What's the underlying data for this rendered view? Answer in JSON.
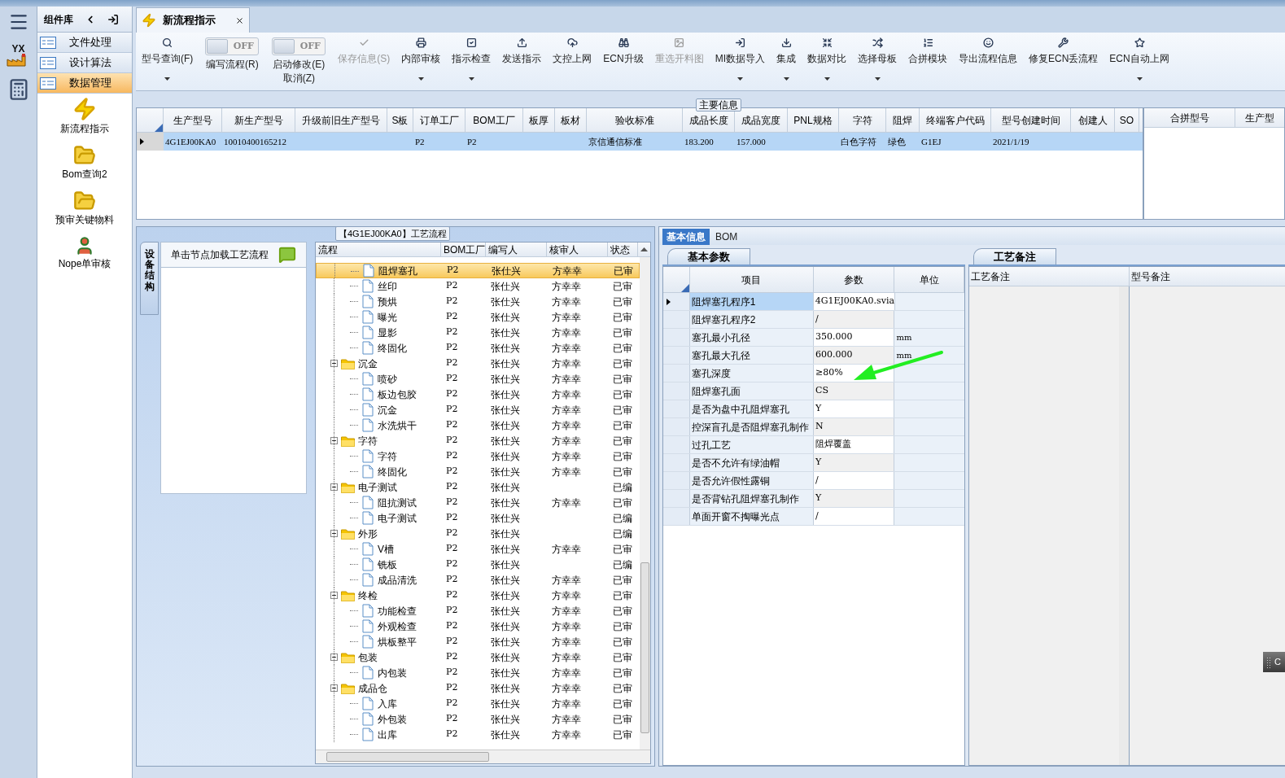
{
  "side_bar": {
    "logo_text": "YX"
  },
  "lib_panel": {
    "title": "组件库",
    "categories": [
      {
        "label": "文件处理",
        "selected": false
      },
      {
        "label": "设计算法",
        "selected": false
      },
      {
        "label": "数据管理",
        "selected": true
      }
    ],
    "launchers": [
      {
        "label": "新流程指示"
      },
      {
        "label": "Bom查询2"
      },
      {
        "label": "预审关键物料"
      },
      {
        "label": "Nope单审核"
      }
    ]
  },
  "doc_tabs": [
    {
      "label": "新流程指示",
      "selected": true
    }
  ],
  "toolbar": [
    {
      "kind": "button",
      "label": "型号查询(F)",
      "dropdown": true,
      "disabled": false
    },
    {
      "kind": "toggle",
      "label": "编写流程(R)",
      "on": false,
      "switch_text": "OFF"
    },
    {
      "kind": "toggle",
      "label": "启动修改(E)",
      "on": false,
      "switch_text": "OFF",
      "sub_label": "取消(Z)"
    },
    {
      "kind": "button",
      "label": "保存信息(S)",
      "dropdown": false,
      "disabled": true
    },
    {
      "kind": "button",
      "label": "内部审核",
      "dropdown": true,
      "disabled": false
    },
    {
      "kind": "button",
      "label": "指示检查",
      "dropdown": true,
      "disabled": false
    },
    {
      "kind": "button",
      "label": "发送指示",
      "dropdown": false,
      "disabled": false
    },
    {
      "kind": "button",
      "label": "文控上网",
      "dropdown": false,
      "disabled": false
    },
    {
      "kind": "button",
      "label": "ECN升级",
      "dropdown": false,
      "disabled": false
    },
    {
      "kind": "button",
      "label": "重选开料图",
      "dropdown": false,
      "disabled": true
    },
    {
      "kind": "button",
      "label": "MI数据导入",
      "dropdown": true,
      "disabled": false
    },
    {
      "kind": "button",
      "label": "集成",
      "dropdown": true,
      "disabled": false
    },
    {
      "kind": "button",
      "label": "数据对比",
      "dropdown": true,
      "disabled": false
    },
    {
      "kind": "button",
      "label": "选择母板",
      "dropdown": true,
      "disabled": false
    },
    {
      "kind": "button",
      "label": "合拼模块",
      "dropdown": false,
      "disabled": false
    },
    {
      "kind": "button",
      "label": "导出流程信息",
      "dropdown": false,
      "disabled": false
    },
    {
      "kind": "button",
      "label": "修复ECN丢流程",
      "dropdown": false,
      "disabled": false
    },
    {
      "kind": "button",
      "label": "ECN自动上网",
      "dropdown": true,
      "disabled": false
    }
  ],
  "main_info": {
    "title": "主要信息",
    "columns": [
      "生产型号",
      "新生产型号",
      "升级前旧生产型号",
      "S板",
      "订单工厂",
      "BOM工厂",
      "板厚",
      "板材",
      "验收标准",
      "成品长度",
      "成品宽度",
      "PNL规格",
      "字符",
      "阻焊",
      "终端客户代码",
      "型号创建时间",
      "创建人",
      "SO"
    ],
    "rows": [
      {
        "selected": true,
        "cells": [
          "4G1EJ00KA0",
          "10010400165212",
          null,
          null,
          "P2",
          "P2",
          null,
          null,
          "京信通信标准",
          "183.200",
          "157.000",
          null,
          "白色字符",
          "绿色",
          "G1EJ",
          "2021/1/19",
          null,
          null
        ]
      }
    ]
  },
  "merge_table": {
    "columns": [
      "合拼型号",
      "生产型"
    ]
  },
  "process": {
    "vertical_tab": "设备结构",
    "hint": "单击节点加载工艺流程",
    "title": "【4G1EJ00KA0】工艺流程",
    "columns": [
      "流程",
      "BOM工厂",
      "编写人",
      "核审人",
      "状态"
    ],
    "rows": [
      {
        "kind": "step",
        "name": "阻焊塞孔",
        "bom": "P2",
        "writer": "张仕兴",
        "reviewer": "方幸幸",
        "status": "已审",
        "selected": true
      },
      {
        "kind": "step",
        "name": "丝印",
        "bom": "P2",
        "writer": "张仕兴",
        "reviewer": "方幸幸",
        "status": "已审",
        "selected": false
      },
      {
        "kind": "step",
        "name": "预烘",
        "bom": "P2",
        "writer": "张仕兴",
        "reviewer": "方幸幸",
        "status": "已审",
        "selected": false
      },
      {
        "kind": "step",
        "name": "曝光",
        "bom": "P2",
        "writer": "张仕兴",
        "reviewer": "方幸幸",
        "status": "已审",
        "selected": false
      },
      {
        "kind": "step",
        "name": "显影",
        "bom": "P2",
        "writer": "张仕兴",
        "reviewer": "方幸幸",
        "status": "已审",
        "selected": false
      },
      {
        "kind": "step",
        "name": "终固化",
        "bom": "P2",
        "writer": "张仕兴",
        "reviewer": "方幸幸",
        "status": "已审",
        "selected": false
      },
      {
        "kind": "group",
        "name": "沉金",
        "bom": "P2",
        "writer": "张仕兴",
        "reviewer": "方幸幸",
        "status": "已审",
        "selected": false,
        "expanded": true,
        "children": [
          {
            "kind": "step",
            "name": "喷砂",
            "bom": "P2",
            "writer": "张仕兴",
            "reviewer": "方幸幸",
            "status": "已审",
            "selected": false
          },
          {
            "kind": "step",
            "name": "板边包胶",
            "bom": "P2",
            "writer": "张仕兴",
            "reviewer": "方幸幸",
            "status": "已审",
            "selected": false
          },
          {
            "kind": "step",
            "name": "沉金",
            "bom": "P2",
            "writer": "张仕兴",
            "reviewer": "方幸幸",
            "status": "已审",
            "selected": false
          },
          {
            "kind": "step",
            "name": "水洗烘干",
            "bom": "P2",
            "writer": "张仕兴",
            "reviewer": "方幸幸",
            "status": "已审",
            "selected": false
          }
        ]
      },
      {
        "kind": "group",
        "name": "字符",
        "bom": "P2",
        "writer": "张仕兴",
        "reviewer": "方幸幸",
        "status": "已审",
        "selected": false,
        "expanded": true,
        "children": [
          {
            "kind": "step",
            "name": "字符",
            "bom": "P2",
            "writer": "张仕兴",
            "reviewer": "方幸幸",
            "status": "已审",
            "selected": false
          },
          {
            "kind": "step",
            "name": "终固化",
            "bom": "P2",
            "writer": "张仕兴",
            "reviewer": "方幸幸",
            "status": "已审",
            "selected": false
          }
        ]
      },
      {
        "kind": "group",
        "name": "电子测试",
        "bom": "P2",
        "writer": "张仕兴",
        "status": "已编",
        "selected": false,
        "expanded": true,
        "children": [
          {
            "kind": "step",
            "name": "阻抗测试",
            "bom": "P2",
            "writer": "张仕兴",
            "reviewer": "方幸幸",
            "status": "已审",
            "selected": false
          },
          {
            "kind": "step",
            "name": "电子测试",
            "bom": "P2",
            "writer": "张仕兴",
            "status": "已编",
            "selected": false
          }
        ]
      },
      {
        "kind": "group",
        "name": "外形",
        "bom": "P2",
        "writer": "张仕兴",
        "status": "已编",
        "selected": false,
        "expanded": true,
        "children": [
          {
            "kind": "step",
            "name": "V槽",
            "bom": "P2",
            "writer": "张仕兴",
            "reviewer": "方幸幸",
            "status": "已审",
            "selected": false
          },
          {
            "kind": "step",
            "name": "铣板",
            "bom": "P2",
            "writer": "张仕兴",
            "status": "已编",
            "selected": false
          },
          {
            "kind": "step",
            "name": "成品清洗",
            "bom": "P2",
            "writer": "张仕兴",
            "reviewer": "方幸幸",
            "status": "已审",
            "selected": false
          }
        ]
      },
      {
        "kind": "group",
        "name": "终检",
        "bom": "P2",
        "writer": "张仕兴",
        "reviewer": "方幸幸",
        "status": "已审",
        "selected": false,
        "expanded": true,
        "children": [
          {
            "kind": "step",
            "name": "功能检查",
            "bom": "P2",
            "writer": "张仕兴",
            "reviewer": "方幸幸",
            "status": "已审",
            "selected": false
          },
          {
            "kind": "step",
            "name": "外观检查",
            "bom": "P2",
            "writer": "张仕兴",
            "reviewer": "方幸幸",
            "status": "已审",
            "selected": false
          },
          {
            "kind": "step",
            "name": "烘板整平",
            "bom": "P2",
            "writer": "张仕兴",
            "reviewer": "方幸幸",
            "status": "已审",
            "selected": false
          }
        ]
      },
      {
        "kind": "group",
        "name": "包装",
        "bom": "P2",
        "writer": "张仕兴",
        "reviewer": "方幸幸",
        "status": "已审",
        "selected": false,
        "expanded": true,
        "children": [
          {
            "kind": "step",
            "name": "内包装",
            "bom": "P2",
            "writer": "张仕兴",
            "reviewer": "方幸幸",
            "status": "已审",
            "selected": false
          }
        ]
      },
      {
        "kind": "group",
        "name": "成品仓",
        "bom": "P2",
        "writer": "张仕兴",
        "reviewer": "方幸幸",
        "status": "已审",
        "selected": false,
        "expanded": true,
        "children": [
          {
            "kind": "step",
            "name": "入库",
            "bom": "P2",
            "writer": "张仕兴",
            "reviewer": "方幸幸",
            "status": "已审",
            "selected": false
          },
          {
            "kind": "step",
            "name": "外包装",
            "bom": "P2",
            "writer": "张仕兴",
            "reviewer": "方幸幸",
            "status": "已审",
            "selected": false
          },
          {
            "kind": "step",
            "name": "出库",
            "bom": "P2",
            "writer": "张仕兴",
            "reviewer": "方幸幸",
            "status": "已审",
            "selected": false
          }
        ]
      }
    ]
  },
  "detail_tabs": [
    {
      "label": "基本信息",
      "selected": true
    },
    {
      "label": "BOM",
      "selected": false
    }
  ],
  "params": {
    "tab": "基本参数",
    "columns": [
      "项目",
      "参数",
      "单位"
    ],
    "rows": [
      {
        "item": "阻焊塞孔程序1",
        "value": "4G1EJ00KA0.svia",
        "selected": true
      },
      {
        "item": "阻焊塞孔程序2",
        "value": "/",
        "selected": false
      },
      {
        "item": "塞孔最小孔径",
        "value": "350.000",
        "unit": "mm",
        "selected": false
      },
      {
        "item": "塞孔最大孔径",
        "value": "600.000",
        "unit": "mm",
        "selected": false
      },
      {
        "item": "塞孔深度",
        "value": "≥80%",
        "selected": false
      },
      {
        "item": "阻焊塞孔面",
        "value": "CS",
        "selected": false
      },
      {
        "item": "是否为盘中孔阻焊塞孔",
        "value": "Y",
        "selected": false
      },
      {
        "item": "控深盲孔是否阻焊塞孔制作",
        "value": "N",
        "selected": false
      },
      {
        "item": "过孔工艺",
        "value": "阻焊覆盖",
        "selected": false
      },
      {
        "item": "是否不允许有绿油帽",
        "value": "Y",
        "selected": false
      },
      {
        "item": "是否允许假性露铜",
        "value": "/",
        "selected": false
      },
      {
        "item": "是否背钻孔阻焊塞孔制作",
        "value": "Y",
        "selected": false
      },
      {
        "item": "单面开窗不掏曝光点",
        "value": "/",
        "selected": false
      }
    ]
  },
  "remarks": {
    "tab": "工艺备注",
    "columns": [
      "工艺备注",
      "型号备注"
    ]
  },
  "floating_widget": {
    "label": "C"
  }
}
